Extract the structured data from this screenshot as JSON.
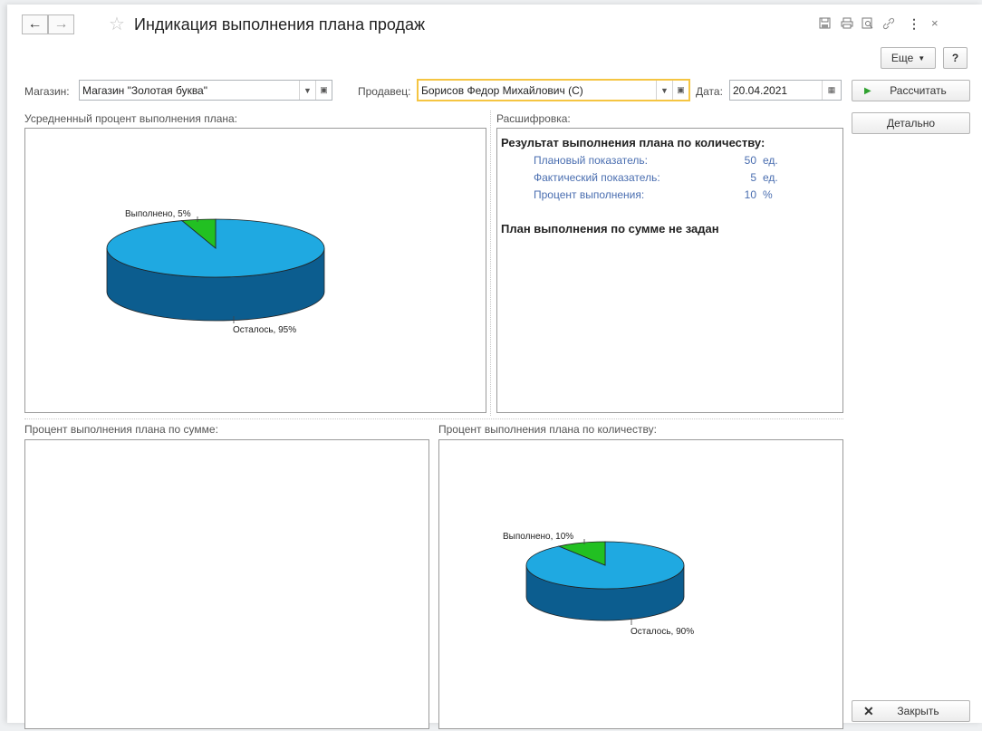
{
  "window": {
    "title": "Индикация выполнения плана продаж",
    "nav": {
      "back_icon": "arrow-left-icon",
      "forward_icon": "arrow-right-icon",
      "favorite_icon": "star-icon"
    },
    "toolbar_icons": [
      "save-icon",
      "print-icon",
      "preview-icon",
      "link-icon",
      "more-vertical-icon",
      "close-icon"
    ]
  },
  "commands": {
    "more_label": "Еще",
    "help_label": "?",
    "calculate_label": "Рассчитать",
    "details_label": "Детально",
    "close_label": "Закрыть"
  },
  "filters": {
    "store_label": "Магазин:",
    "store_value": "Магазин \"Золотая буква\"",
    "seller_label": "Продавец:",
    "seller_value": "Борисов Федор Михайлович (С)",
    "date_label": "Дата:",
    "date_value": "20.04.2021"
  },
  "sections": {
    "average_title": "Усредненный процент выполнения плана:",
    "breakdown_title": "Расшифровка:",
    "sum_title": "Процент выполнения плана по сумме:",
    "qty_title": "Процент выполнения плана по количеству:"
  },
  "breakdown": {
    "qty_header": "Результат выполнения плана по количеству:",
    "rows": [
      {
        "label": "Плановый показатель:",
        "value": "50",
        "unit": "ед."
      },
      {
        "label": "Фактический показатель:",
        "value": "5",
        "unit": "ед."
      },
      {
        "label": "Процент выполнения:",
        "value": "10",
        "unit": "%"
      }
    ],
    "sum_note": "План выполнения по сумме не задан"
  },
  "chart_data": [
    {
      "type": "pie",
      "title": "Усредненный процент выполнения плана:",
      "slices": [
        {
          "label": "Выполнено, 5%",
          "value": 5,
          "color": "#22c022"
        },
        {
          "label": "Осталось, 95%",
          "value": 95,
          "color": "#1fa9e1"
        }
      ],
      "style": "3d"
    },
    {
      "type": "pie",
      "title": "Процент выполнения плана по количеству:",
      "slices": [
        {
          "label": "Выполнено, 10%",
          "value": 10,
          "color": "#22c022"
        },
        {
          "label": "Осталось, 90%",
          "value": 90,
          "color": "#1fa9e1"
        }
      ],
      "style": "3d"
    }
  ],
  "colors": {
    "accent_green": "#2fa12f",
    "focus": "#f5c542",
    "link_blue": "#4a6eb0",
    "pie_blue": "#1fa9e1",
    "pie_side": "#0c5d8f",
    "pie_green": "#22c022"
  }
}
